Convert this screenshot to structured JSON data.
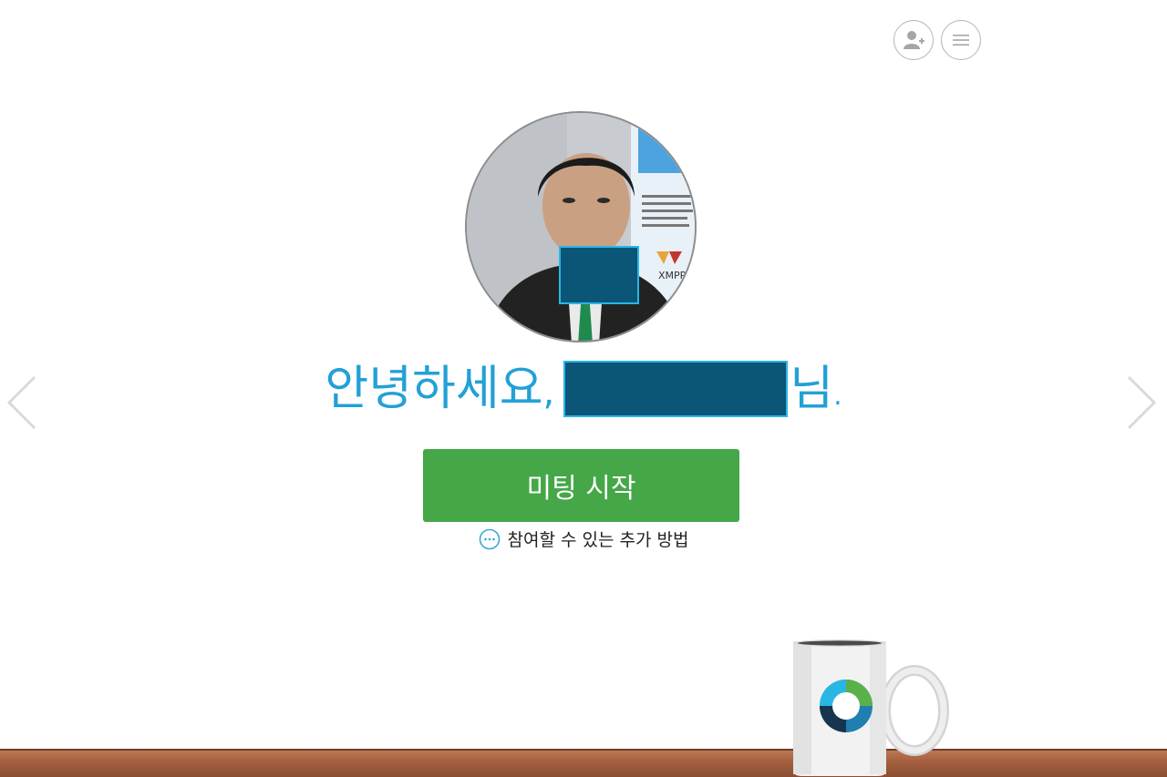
{
  "header": {
    "add_contact_icon": "person-add-icon",
    "menu_icon": "hamburger-menu-icon"
  },
  "profile": {
    "avatar_description": "user profile photo",
    "poster_text": "XMPP"
  },
  "greeting": {
    "prefix": "안녕하세요",
    "comma": ",",
    "suffix": "님",
    "period": "."
  },
  "actions": {
    "start_meeting_label": "미팅 시작",
    "more_ways_label": "참여할 수 있는 추가 방법"
  },
  "colors": {
    "accent_blue": "#22a1d6",
    "start_green": "#45a747",
    "redaction": "#0b5576"
  }
}
